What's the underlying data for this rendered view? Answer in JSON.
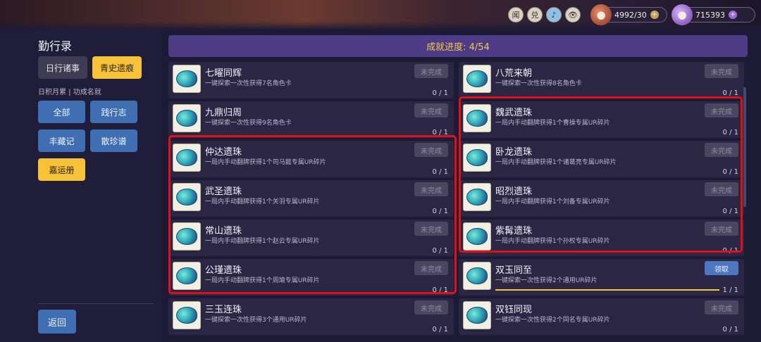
{
  "header": {
    "icons": [
      {
        "name": "news-icon",
        "glyph": "闻"
      },
      {
        "name": "exchange-icon",
        "glyph": "兑"
      },
      {
        "name": "music-icon",
        "glyph": "♪"
      },
      {
        "name": "eye-icon",
        "glyph": "👁"
      }
    ],
    "currency1": {
      "value": "4992/30",
      "icon": "coin-bag-icon"
    },
    "currency2": {
      "value": "715393",
      "icon": "gem-bag-icon"
    }
  },
  "sidebar": {
    "title": "勤行录",
    "tabs": [
      {
        "label": "日行诸事",
        "active": false
      },
      {
        "label": "青史遗痕",
        "active": true
      }
    ],
    "subtitle": "日积月累 | 功成名就",
    "categories": [
      {
        "label": "全部",
        "active": false
      },
      {
        "label": "践行志",
        "active": false
      },
      {
        "label": "丰藏记",
        "active": false
      },
      {
        "label": "散珍谱",
        "active": false
      },
      {
        "label": "嘉运册",
        "active": true
      }
    ],
    "back_label": "返回"
  },
  "main": {
    "progress_label": "成就进度: 4/54",
    "left_column": [
      {
        "name": "七曜同辉",
        "desc": "一键探索一次性获得7名角色卡",
        "status": "未完成",
        "count": "0 / 1"
      },
      {
        "name": "九鼎归周",
        "desc": "一键探索一次性获得9名角色卡",
        "status": "未完成",
        "count": "0 / 1"
      },
      {
        "name": "仲达遗珠",
        "desc": "一局内手动翻牌获得1个司马懿专属UR碎片",
        "status": "未完成",
        "count": "0 / 1"
      },
      {
        "name": "武圣遗珠",
        "desc": "一局内手动翻牌获得1个关羽专属UR碎片",
        "status": "未完成",
        "count": "0 / 1"
      },
      {
        "name": "常山遗珠",
        "desc": "一局内手动翻牌获得1个赵云专属UR碎片",
        "status": "未完成",
        "count": "0 / 1"
      },
      {
        "name": "公瑾遗珠",
        "desc": "一局内手动翻牌获得1个周瑜专属UR碎片",
        "status": "未完成",
        "count": "0 / 1"
      },
      {
        "name": "三玉连珠",
        "desc": "一键探索一次性获得3个通用UR碎片",
        "status": "未完成",
        "count": "0 / 1"
      }
    ],
    "right_column": [
      {
        "name": "八荒来朝",
        "desc": "一键探索一次性获得8名角色卡",
        "status": "未完成",
        "count": "0 / 1"
      },
      {
        "name": "魏武遗珠",
        "desc": "一局内手动翻牌获得1个曹操专属UR碎片",
        "status": "未完成",
        "count": "0 / 1"
      },
      {
        "name": "卧龙遗珠",
        "desc": "一局内手动翻牌获得1个诸葛亮专属UR碎片",
        "status": "未完成",
        "count": "0 / 1"
      },
      {
        "name": "昭烈遗珠",
        "desc": "一局内手动翻牌获得1个刘备专属UR碎片",
        "status": "未完成",
        "count": "0 / 1"
      },
      {
        "name": "紫髯遗珠",
        "desc": "一局内手动翻牌获得1个孙权专属UR碎片",
        "status": "未完成",
        "count": "0 / 1"
      },
      {
        "name": "双玉同至",
        "desc": "一键探索一次性获得2个通用UR碎片",
        "status": "领取",
        "count": "1 / 1",
        "progress": 1.0
      },
      {
        "name": "双钰同现",
        "desc": "一键探索一次性获得2个同名专属UR碎片",
        "status": "未完成",
        "count": "0 / 1"
      }
    ]
  },
  "colors": {
    "accent_yellow": "#f5c238",
    "button_blue": "#3f6fb2",
    "highlight_red": "#e0101a",
    "header_purple": "#4e3b86"
  }
}
